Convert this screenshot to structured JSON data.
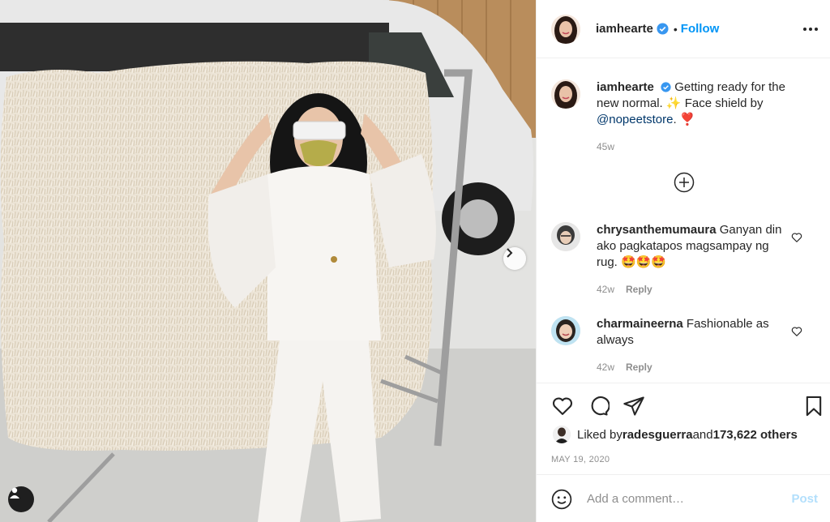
{
  "post": {
    "author": "iamhearte",
    "follow_label": "Follow",
    "separator": "•",
    "caption": {
      "username": "iamhearte",
      "text_a": "Getting ready for the new normal. ",
      "emoji_a": "✨",
      "text_b": " Face shield by ",
      "mention": "@nopeetstore",
      "text_c": ". ",
      "emoji_b": "❣️",
      "age": "45w"
    },
    "comments": [
      {
        "username": "chrysanthemumaura",
        "text": "Ganyan din ako pagkatapos magsampay ng rug. ",
        "emoji": "🤩🤩🤩",
        "age": "42w",
        "reply_label": "Reply"
      },
      {
        "username": "charmaineerna",
        "text": "Fashionable as always",
        "emoji": "",
        "age": "42w",
        "reply_label": "Reply"
      }
    ],
    "likes": {
      "prefix": "Liked by ",
      "user": "radesguerra",
      "and": " and ",
      "others": "173,622 others"
    },
    "date": "MAY 19, 2020",
    "add_comment_placeholder": "Add a comment…",
    "post_label": "Post"
  },
  "colors": {
    "link_blue": "#0095f6",
    "post_disabled": "#b2dffc",
    "muted": "#8e8e8e"
  },
  "icons": [
    "verified-badge-icon",
    "more-options-icon",
    "load-more-comments-icon",
    "heart-icon",
    "comment-icon",
    "share-icon",
    "bookmark-icon",
    "emoji-icon",
    "carousel-next-icon",
    "tagged-user-icon"
  ]
}
